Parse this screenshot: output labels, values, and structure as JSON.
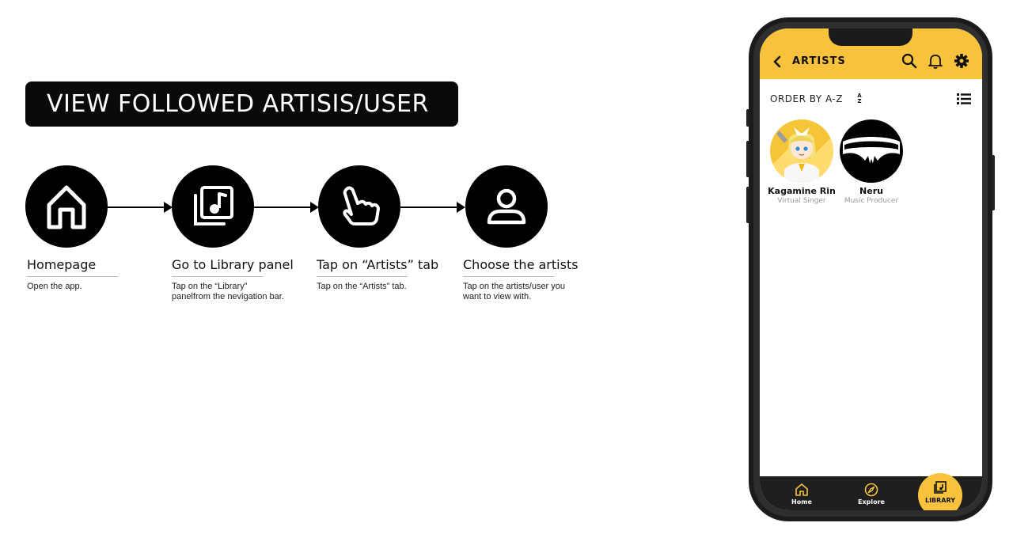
{
  "banner": {
    "title": "VIEW FOLLOWED ARTISIS/USER"
  },
  "steps": [
    {
      "icon": "home-icon",
      "title": "Homepage",
      "desc_lines": [
        "Open the app."
      ]
    },
    {
      "icon": "music-library-icon",
      "title": "Go to Library panel",
      "desc_lines": [
        "Tap on the “Library”",
        "panelfrom the nevigation bar."
      ]
    },
    {
      "icon": "tap-hand-icon",
      "title": "Tap on “Artists” tab",
      "desc_lines": [
        "Tap on the “Artists” tab."
      ]
    },
    {
      "icon": "user-icon",
      "title": "Choose the artists",
      "desc_lines": [
        "Tap on the artists/user you",
        "want to view with."
      ]
    }
  ],
  "phone": {
    "header": {
      "title": "ARTISTS",
      "accent": "#f9c23c"
    },
    "order_label": "ORDER BY A-Z",
    "sort_badge": {
      "top": "A",
      "bottom": "Z"
    },
    "artists": [
      {
        "name": "Kagamine Rin",
        "role": "Virtual Singer"
      },
      {
        "name": "Neru",
        "role": "Music Producer"
      }
    ],
    "nav": {
      "home": "Home",
      "explore": "Explore",
      "library": "LIBRARY"
    }
  }
}
